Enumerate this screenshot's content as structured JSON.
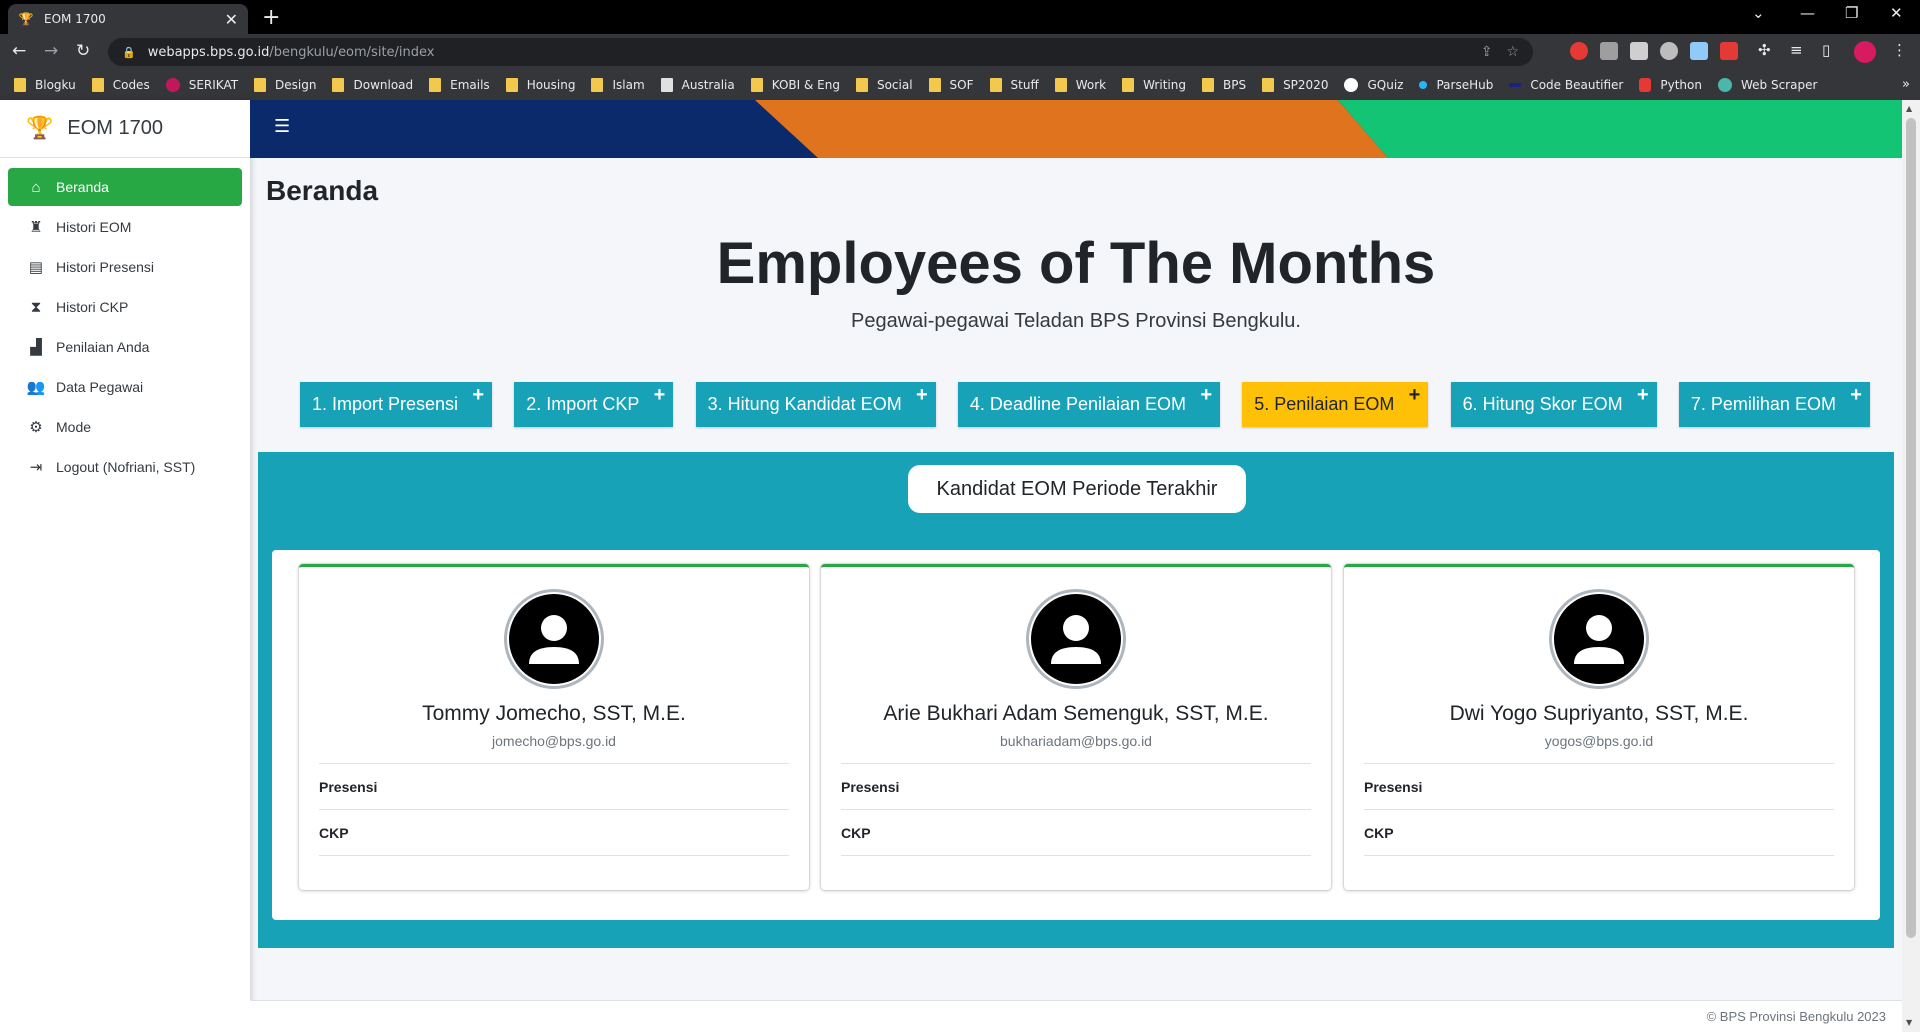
{
  "browser": {
    "tab_title": "EOM 1700",
    "url_host": "webapps.bps.go.id",
    "url_path": "/bengkulu/eom/site/index",
    "bookmarks": [
      {
        "label": "Blogku"
      },
      {
        "label": "Codes"
      },
      {
        "label": "SERIKAT"
      },
      {
        "label": "Design"
      },
      {
        "label": "Download"
      },
      {
        "label": "Emails"
      },
      {
        "label": "Housing"
      },
      {
        "label": "Islam"
      },
      {
        "label": "Australia"
      },
      {
        "label": "KOBI & Eng"
      },
      {
        "label": "Social"
      },
      {
        "label": "SOF"
      },
      {
        "label": "Stuff"
      },
      {
        "label": "Work"
      },
      {
        "label": "Writing"
      },
      {
        "label": "BPS"
      },
      {
        "label": "SP2020"
      },
      {
        "label": "GQuiz"
      },
      {
        "label": "ParseHub"
      },
      {
        "label": "Code Beautifier"
      },
      {
        "label": "Python"
      },
      {
        "label": "Web Scraper"
      }
    ],
    "more_bookmarks": "»"
  },
  "sidebar": {
    "brand": "EOM 1700",
    "items": [
      {
        "label": "Beranda",
        "icon": "home-icon",
        "active": true
      },
      {
        "label": "Histori EOM",
        "icon": "trophy-icon"
      },
      {
        "label": "Histori Presensi",
        "icon": "file-icon"
      },
      {
        "label": "Histori CKP",
        "icon": "hourglass-icon"
      },
      {
        "label": "Penilaian Anda",
        "icon": "chart-icon"
      },
      {
        "label": "Data Pegawai",
        "icon": "users-icon"
      },
      {
        "label": "Mode",
        "icon": "gear-icon"
      },
      {
        "label": "Logout (Nofriani, SST)",
        "icon": "logout-icon"
      }
    ]
  },
  "main": {
    "page_title": "Beranda",
    "hero_title": "Employees of The Months",
    "hero_subtitle": "Pegawai-pegawai Teladan BPS Provinsi Bengkulu.",
    "steps": [
      {
        "label": "1. Import Presensi"
      },
      {
        "label": "2. Import CKP"
      },
      {
        "label": "3. Hitung Kandidat EOM"
      },
      {
        "label": "4. Deadline Penilaian EOM"
      },
      {
        "label": "5. Penilaian EOM"
      },
      {
        "label": "6. Hitung Skor EOM"
      },
      {
        "label": "7. Pemilihan EOM"
      }
    ],
    "candidates_title": "Kandidat EOM Periode Terakhir",
    "candidates": [
      {
        "name": "Tommy Jomecho, SST, M.E.",
        "email": "jomecho@bps.go.id",
        "row1": "Presensi",
        "row2": "CKP"
      },
      {
        "name": "Arie Bukhari Adam Semenguk, SST, M.E.",
        "email": "bukhariadam@bps.go.id",
        "row1": "Presensi",
        "row2": "CKP"
      },
      {
        "name": "Dwi Yogo Supriyanto, SST, M.E.",
        "email": "yogos@bps.go.id",
        "row1": "Presensi",
        "row2": "CKP"
      }
    ]
  },
  "footer": {
    "text": "© BPS Provinsi Bengkulu 2023"
  },
  "colors": {
    "primary_teal": "#17a2b8",
    "active_green": "#28a745",
    "warning_yellow": "#ffc107",
    "banner_navy": "#0a2a6b",
    "banner_orange": "#e0741e",
    "banner_green": "#12c474"
  }
}
